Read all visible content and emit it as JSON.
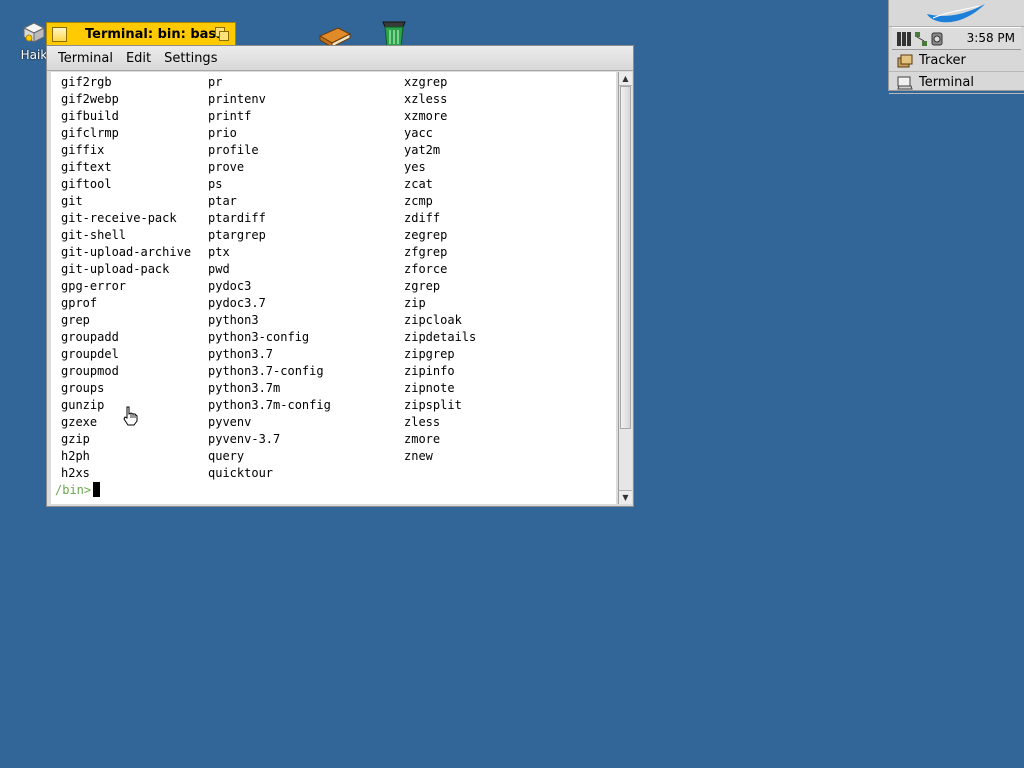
{
  "desktop": {
    "icons": [
      {
        "label": "Haik",
        "icon": "haiku-volume-icon"
      },
      {
        "label": "",
        "icon": "book-icon"
      },
      {
        "label": "",
        "icon": "trash-icon"
      }
    ]
  },
  "deskbar": {
    "clock": "3:58 PM",
    "apps": [
      {
        "label": "Tracker",
        "icon": "tracker-icon"
      },
      {
        "label": "Terminal",
        "icon": "terminal-icon"
      }
    ]
  },
  "window": {
    "title": "Terminal: bin: bash",
    "menu": [
      "Terminal",
      "Edit",
      "Settings"
    ]
  },
  "terminal": {
    "rows": [
      [
        "gif2rgb",
        "pr",
        "xzgrep"
      ],
      [
        "gif2webp",
        "printenv",
        "xzless"
      ],
      [
        "gifbuild",
        "printf",
        "xzmore"
      ],
      [
        "gifclrmp",
        "prio",
        "yacc"
      ],
      [
        "giffix",
        "profile",
        "yat2m"
      ],
      [
        "giftext",
        "prove",
        "yes"
      ],
      [
        "giftool",
        "ps",
        "zcat"
      ],
      [
        "git",
        "ptar",
        "zcmp"
      ],
      [
        "git-receive-pack",
        "ptardiff",
        "zdiff"
      ],
      [
        "git-shell",
        "ptargrep",
        "zegrep"
      ],
      [
        "git-upload-archive",
        "ptx",
        "zfgrep"
      ],
      [
        "git-upload-pack",
        "pwd",
        "zforce"
      ],
      [
        "gpg-error",
        "pydoc3",
        "zgrep"
      ],
      [
        "gprof",
        "pydoc3.7",
        "zip"
      ],
      [
        "grep",
        "python3",
        "zipcloak"
      ],
      [
        "groupadd",
        "python3-config",
        "zipdetails"
      ],
      [
        "groupdel",
        "python3.7",
        "zipgrep"
      ],
      [
        "groupmod",
        "python3.7-config",
        "zipinfo"
      ],
      [
        "groups",
        "python3.7m",
        "zipnote"
      ],
      [
        "gunzip",
        "python3.7m-config",
        "zipsplit"
      ],
      [
        "gzexe",
        "pyvenv",
        "zless"
      ],
      [
        "gzip",
        "pyvenv-3.7",
        "zmore"
      ],
      [
        "h2ph",
        "query",
        "znew"
      ],
      [
        "h2xs",
        "quicktour",
        ""
      ]
    ],
    "prompt": "/bin>"
  },
  "colors": {
    "desktop": "#336698",
    "tab": "#ffcb00",
    "prompt": "#6aa84f"
  }
}
